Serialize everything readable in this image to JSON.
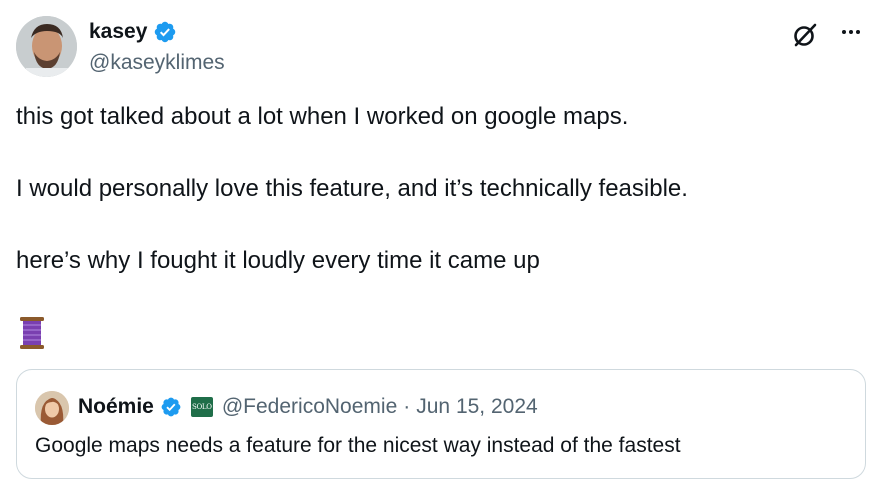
{
  "author": {
    "name": "kasey",
    "handle": "@kaseyklimes",
    "verified": true
  },
  "tweet": {
    "paragraphs": [
      "this got talked about a lot when I worked on google maps.",
      "I would personally love this feature, and it’s technically feasible.",
      "here’s why I fought it loudly every time it came up"
    ],
    "emoji": "thread-spool-icon"
  },
  "quote": {
    "name": "Noémie",
    "verified": true,
    "affiliation_badge": "SOLO",
    "handle": "@FedericoNoemie",
    "separator": "·",
    "date": "Jun 15, 2024",
    "text": "Google maps needs a feature for the nicest way instead of the fastest"
  },
  "icons": {
    "grok": "grok-icon",
    "more": "more-icon",
    "verified_color": "#1d9bf0"
  }
}
